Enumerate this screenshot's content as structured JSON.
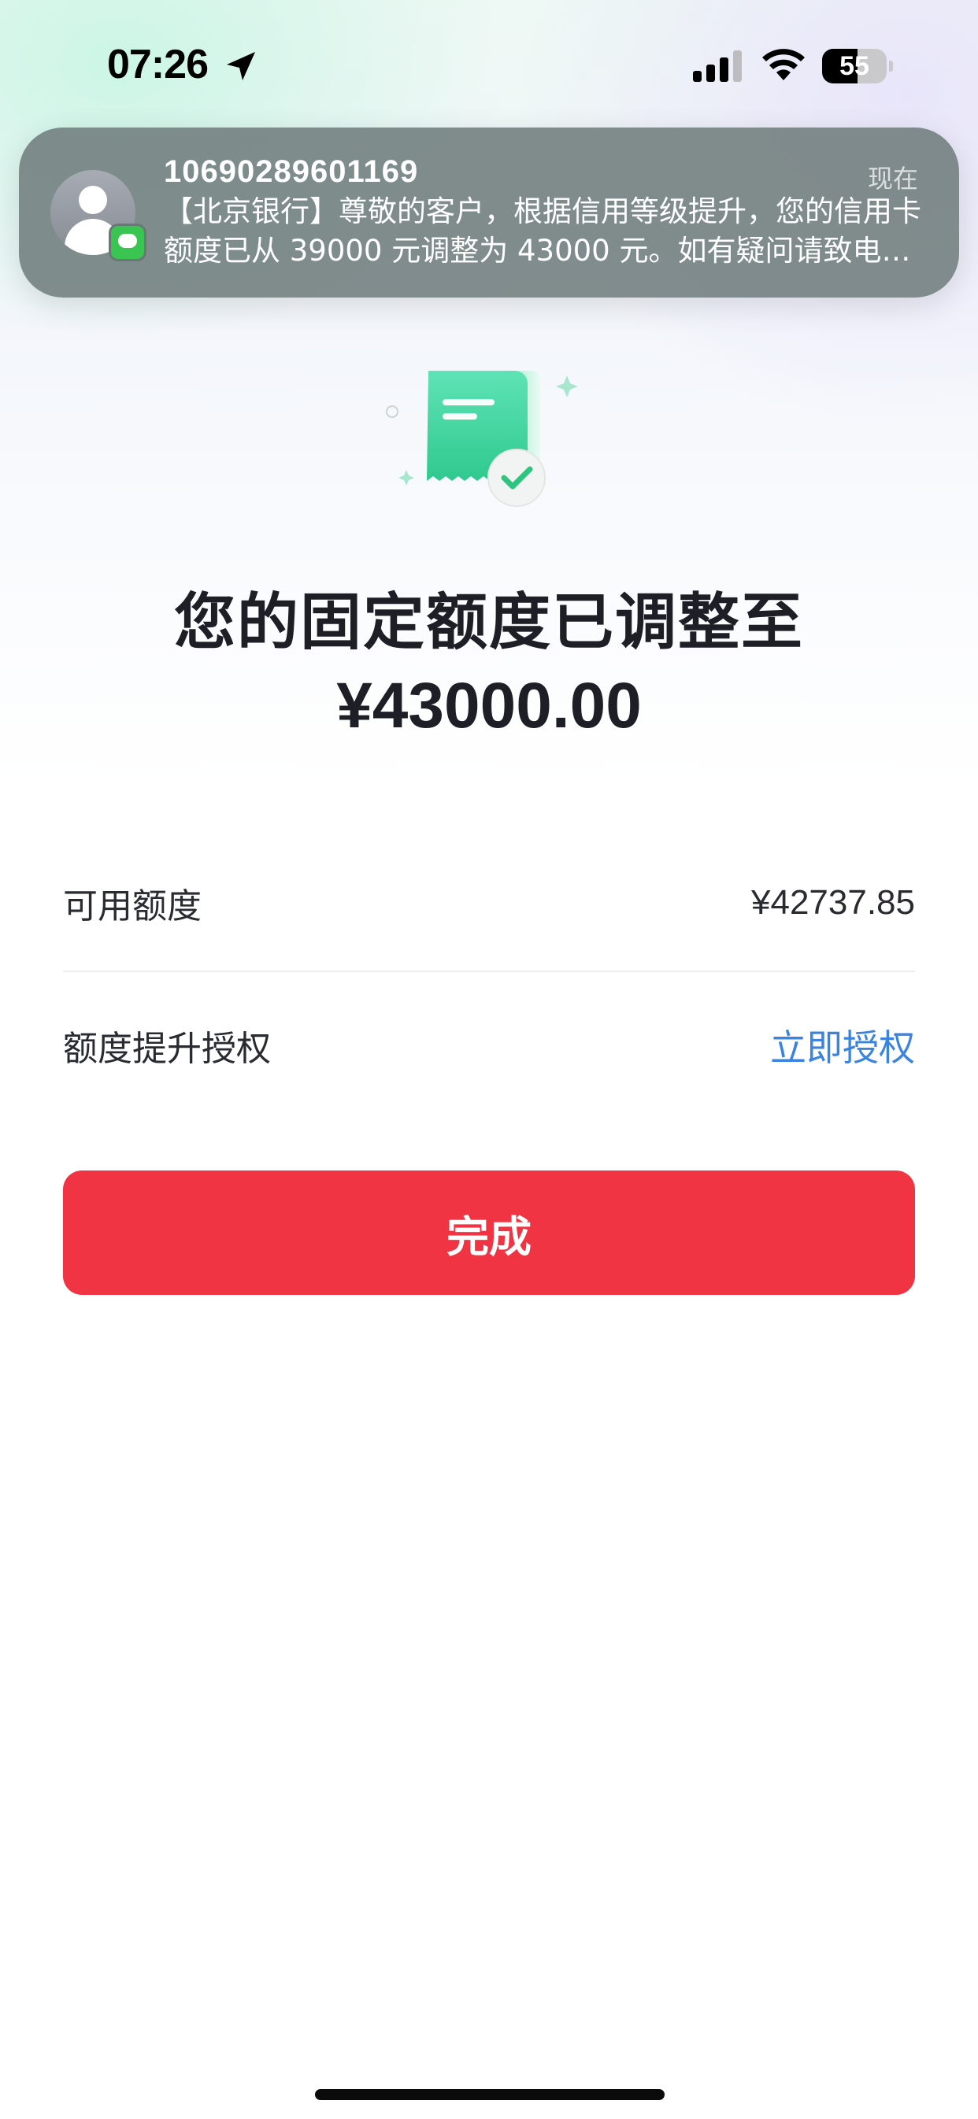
{
  "status_bar": {
    "time": "07:26",
    "battery_level": "55",
    "battery_fraction": 0.55
  },
  "notification": {
    "sender": "10690289601169",
    "time": "现在",
    "body": "【北京银行】尊敬的客户，根据信用等级提升，您的信用卡额度已从 39000 元调整为 43000 元。如有疑问请致电客服热线。",
    "app_icon": "messages-icon",
    "avatar_icon": "person-icon"
  },
  "result": {
    "illustration": "receipt-check-icon",
    "headline": "您的固定额度已调整至",
    "amount": "¥43000.00"
  },
  "details": {
    "available_label": "可用额度",
    "available_value": "¥42737.85",
    "authorize_label": "额度提升授权",
    "authorize_link": "立即授权"
  },
  "actions": {
    "done_label": "完成"
  },
  "colors": {
    "primary_button": "#f03443",
    "link": "#3a84e0",
    "illustration_green": "#3dd6a0"
  }
}
